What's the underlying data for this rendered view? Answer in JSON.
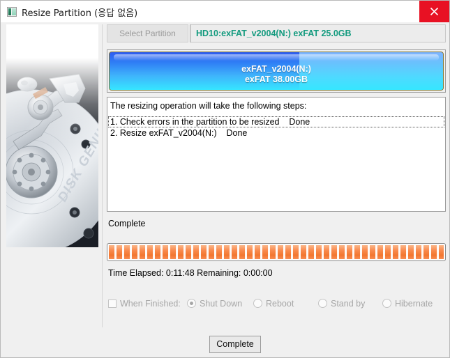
{
  "window": {
    "title": "Resize Partition (응답 없음)",
    "title_icon": "partition-app-icon",
    "close_icon": "close-icon",
    "accent_close_color": "#e81123"
  },
  "sidebar": {
    "image_name": "disk-genius-hard-drive-illustration",
    "brand_text": "DISK GENIUS"
  },
  "header": {
    "select_partition_label": "Select Partition",
    "partition_summary": "HD10:exFAT_v2004(N:) exFAT 25.0GB",
    "partition_summary_color": "#129a7e"
  },
  "partition_map": {
    "volume_label": "exFAT_v2004(N:)",
    "volume_size": "exFAT 38.00GB",
    "used_percent": 57,
    "used_color": "#2f7ff5",
    "free_color": "#68c2fd",
    "border_color": "#8a7a2e"
  },
  "steps": {
    "intro": "The resizing operation will take the following steps:",
    "items": [
      {
        "text": "1. Check errors in the partition to be resized    Done",
        "focused": true
      },
      {
        "text": "2. Resize exFAT_v2004(N:)    Done",
        "focused": false
      }
    ]
  },
  "progress": {
    "status": "Complete",
    "percent": 100,
    "bar_color": "#f2762f",
    "time_text": "Time Elapsed:  0:11:48  Remaining:  0:00:00"
  },
  "when_finished": {
    "checkbox_label": "When Finished:",
    "checkbox_checked": false,
    "enabled": false,
    "options": [
      {
        "label": "Shut Down",
        "selected": true
      },
      {
        "label": "Reboot",
        "selected": false
      },
      {
        "label": "Stand by",
        "selected": false
      },
      {
        "label": "Hibernate",
        "selected": false
      }
    ]
  },
  "footer": {
    "complete_button_label": "Complete"
  }
}
